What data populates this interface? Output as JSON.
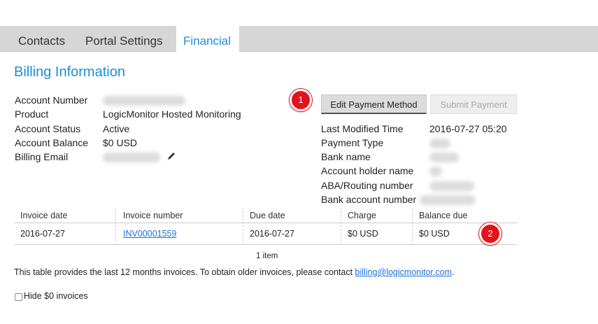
{
  "tabs": [
    {
      "label": "Contacts"
    },
    {
      "label": "Portal Settings"
    },
    {
      "label": "Financial"
    }
  ],
  "page_title": "Billing Information",
  "account": {
    "labels": [
      "Account Number",
      "Product",
      "Account Status",
      "Account Balance",
      "Billing Email"
    ],
    "product": "LogicMonitor Hosted Monitoring",
    "status": "Active",
    "balance": "$0 USD"
  },
  "payment": {
    "edit_label": "Edit Payment Method",
    "submit_label": "Submit Payment",
    "labels": [
      "Last Modified Time",
      "Payment Type",
      "Bank name",
      "Account holder name",
      "ABA/Routing number",
      "Bank account number"
    ],
    "last_modified": "2016-07-27 05:20"
  },
  "callouts": [
    "1",
    "2"
  ],
  "table": {
    "headers": [
      "Invoice date",
      "Invoice number",
      "Due date",
      "Charge",
      "Balance due"
    ],
    "rows": [
      {
        "invoice_date": "2016-07-27",
        "invoice_number": "INV00001559",
        "due_date": "2016-07-27",
        "charge": "$0 USD",
        "balance_due": "$0 USD"
      }
    ],
    "count": "1 item"
  },
  "footer": {
    "note_prefix": "This table provides the last 12 months invoices. To obtain older invoices, please contact ",
    "email": "billing@logicmonitor.com",
    "note_suffix": "."
  },
  "hide_zero": {
    "label": "Hide $0 invoices",
    "checked": false
  },
  "colors": {
    "accent": "#1a8fd9",
    "callout": "#e3131c",
    "tabbar": "#d6d6d6"
  }
}
